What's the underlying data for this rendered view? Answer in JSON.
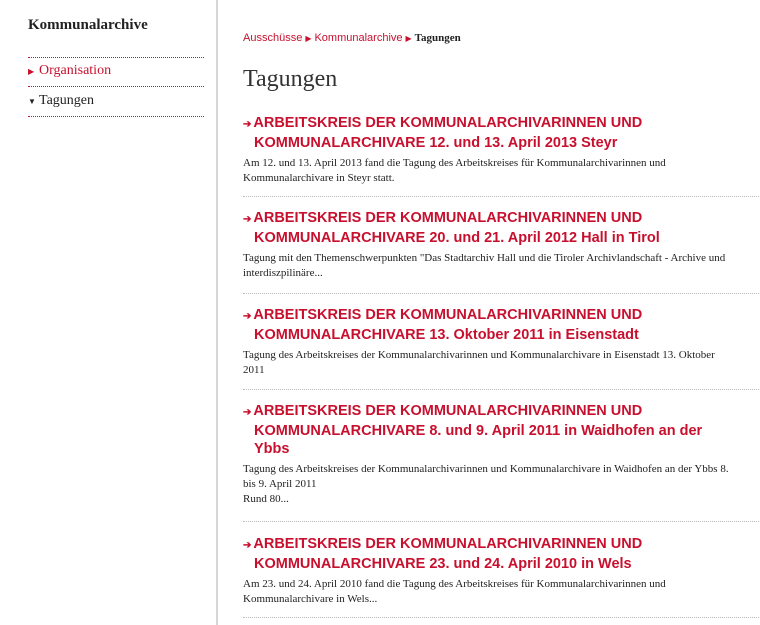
{
  "sidebar": {
    "title": "Kommunalarchive",
    "items": [
      {
        "label": "Organisation"
      },
      {
        "label": "Tagungen"
      }
    ]
  },
  "breadcrumb": {
    "items": [
      "Ausschüsse",
      "Kommunalarchive"
    ],
    "current": "Tagungen"
  },
  "page": {
    "title": "Tagungen"
  },
  "entries": [
    {
      "title_line1": "ARBEITSKREIS DER KOMMUNALARCHIVARINNEN UND",
      "title_line2": "KOMMUNALARCHIVARE 12. und 13. April 2013 Steyr",
      "title_line3": "",
      "desc_line1": "Am 12. und 13. April 2013 fand die Tagung des Arbeitskreises für Kommunalarchivarinnen und",
      "desc_line2": "Kommunalarchivare in Steyr statt.",
      "desc_line3": ""
    },
    {
      "title_line1": "ARBEITSKREIS DER KOMMUNALARCHIVARINNEN UND",
      "title_line2": "KOMMUNALARCHIVARE 20. und 21. April 2012 Hall in Tirol",
      "title_line3": "",
      "desc_line1": "Tagung mit den Themenschwerpunkten \"Das Stadtarchiv Hall und die Tiroler Archivlandschaft - Archive und",
      "desc_line2": "interdiszpilinäre...",
      "desc_line3": ""
    },
    {
      "title_line1": "ARBEITSKREIS DER KOMMUNALARCHIVARINNEN UND",
      "title_line2": "KOMMUNALARCHIVARE 13. Oktober 2011 in Eisenstadt",
      "title_line3": "",
      "desc_line1": "Tagung des Arbeitskreises der Kommunalarchivarinnen und Kommunalarchivare in Eisenstadt 13. Oktober",
      "desc_line2": "2011",
      "desc_line3": ""
    },
    {
      "title_line1": "ARBEITSKREIS DER KOMMUNALARCHIVARINNEN UND",
      "title_line2": "KOMMUNALARCHIVARE 8. und 9. April 2011 in Waidhofen an der",
      "title_line3": "Ybbs",
      "desc_line1": "Tagung des Arbeitskreises der Kommunalarchivarinnen und Kommunalarchivare in Waidhofen an der Ybbs 8.",
      "desc_line2": "bis 9. April 2011",
      "desc_line3": "Rund 80..."
    },
    {
      "title_line1": "ARBEITSKREIS DER KOMMUNALARCHIVARINNEN UND",
      "title_line2": "KOMMUNALARCHIVARE 23. und 24. April 2010 in Wels",
      "title_line3": "",
      "desc_line1": "Am 23. und 24. April 2010 fand die Tagung des Arbeitskreises für Kommunalarchivarinnen und",
      "desc_line2": "Kommunalarchivare in Wels...",
      "desc_line3": ""
    }
  ]
}
